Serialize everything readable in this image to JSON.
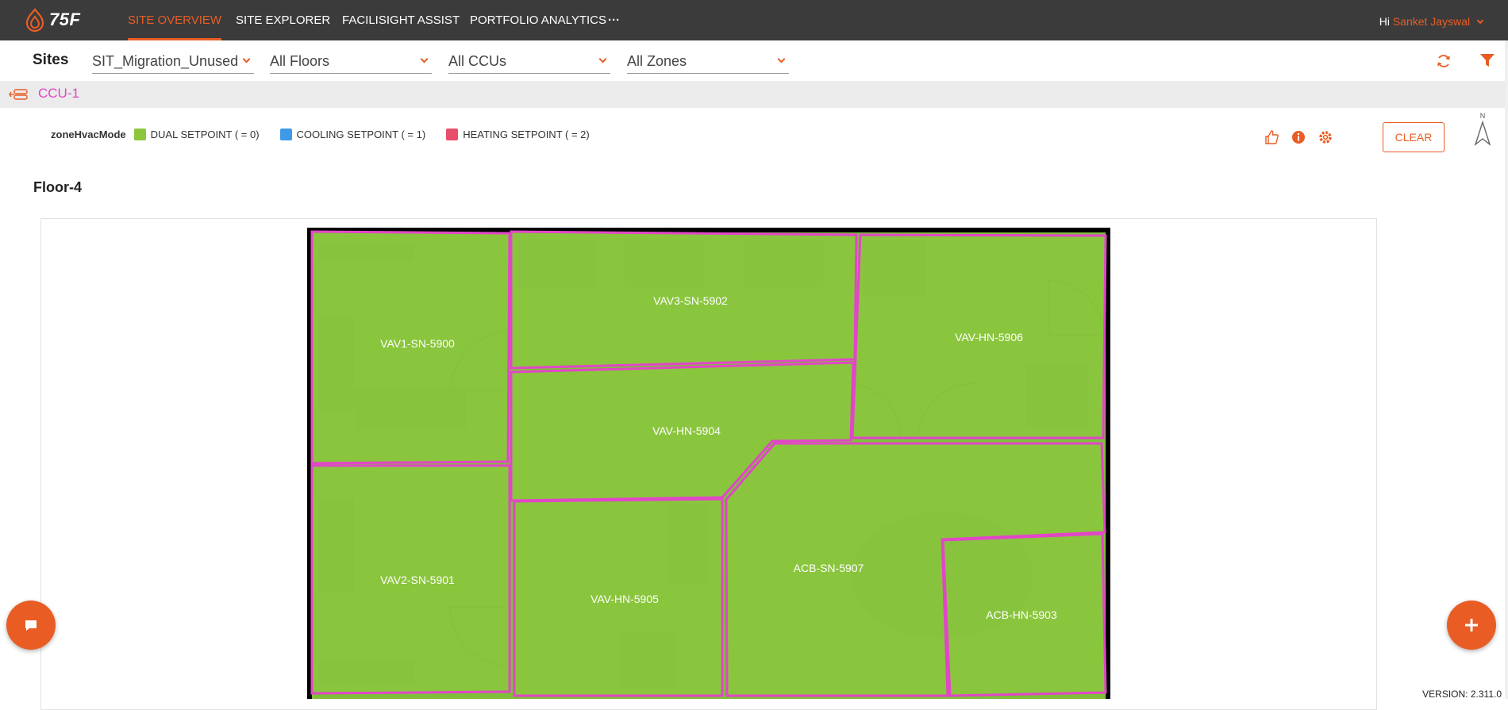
{
  "brand": {
    "logo_text": "75F"
  },
  "nav": {
    "tabs": [
      {
        "label": "SITE OVERVIEW"
      },
      {
        "label": "SITE EXPLORER"
      },
      {
        "label": "FACILISIGHT ASSIST"
      },
      {
        "label": "PORTFOLIO ANALYTICS"
      },
      {
        "label": "···"
      }
    ],
    "greeting": "Hi",
    "user": "Sanket Jayswal"
  },
  "filters": {
    "sites_label": "Sites",
    "site": "SIT_Migration_Unused",
    "floor": "All Floors",
    "ccu": "All CCUs",
    "zone": "All Zones"
  },
  "ccu": {
    "label": "CCU-1"
  },
  "legend": {
    "title": "zoneHvacMode",
    "items": [
      {
        "label": "DUAL SETPOINT ( = 0)",
        "color": "#8cc63f"
      },
      {
        "label": "COOLING SETPOINT ( = 1)",
        "color": "#3e9ae6"
      },
      {
        "label": "HEATING SETPOINT ( = 2)",
        "color": "#e84e6a"
      }
    ]
  },
  "actions": {
    "clear_label": "CLEAR",
    "north_label": "N"
  },
  "floor": {
    "title": "Floor-4",
    "zones": [
      {
        "name": "VAV1-SN-5900"
      },
      {
        "name": "VAV3-SN-5902"
      },
      {
        "name": "VAV-HN-5906"
      },
      {
        "name": "VAV-HN-5904"
      },
      {
        "name": "VAV2-SN-5901"
      },
      {
        "name": "VAV-HN-5905"
      },
      {
        "name": "ACB-SN-5907"
      },
      {
        "name": "ACB-HN-5903"
      }
    ]
  },
  "colors": {
    "accent": "#e95d25",
    "zone_fill": "#8cc63f",
    "zone_border": "#e246c8",
    "nav_bg": "#3b3b3b"
  },
  "footer": {
    "version": "VERSION: 2.311.0"
  }
}
